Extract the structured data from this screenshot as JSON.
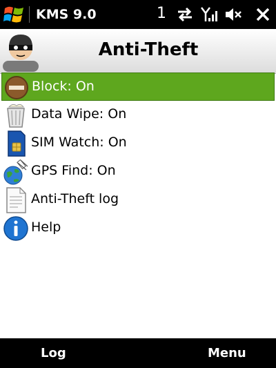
{
  "status": {
    "title": "KMS 9.0",
    "notification_count": "1",
    "icons": [
      "windows-start-icon",
      "sync-arrows-icon",
      "signal-icon",
      "volume-mute-icon",
      "close-icon"
    ]
  },
  "header": {
    "title": "Anti-Theft",
    "avatar": "thief-avatar-icon"
  },
  "menu": {
    "items": [
      {
        "label": "Block: On",
        "icon": "block-icon",
        "selected": true
      },
      {
        "label": "Data Wipe: On",
        "icon": "trash-icon"
      },
      {
        "label": "SIM Watch: On",
        "icon": "sim-card-icon"
      },
      {
        "label": "GPS Find: On",
        "icon": "globe-satellite-icon"
      },
      {
        "label": "Anti-Theft log",
        "icon": "document-icon"
      },
      {
        "label": "Help",
        "icon": "info-icon"
      }
    ]
  },
  "softkeys": {
    "left": "Log",
    "right": "Menu"
  },
  "colors": {
    "selection": "#5ea71e",
    "bar": "#000000"
  }
}
